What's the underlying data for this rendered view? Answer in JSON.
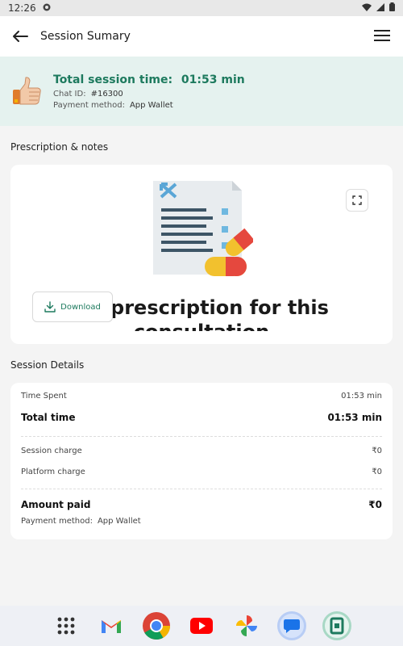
{
  "status_bar": {
    "time": "12:26"
  },
  "header": {
    "title": "Session Sumary"
  },
  "summary": {
    "total_label": "Total session time:",
    "total_value": "01:53 min",
    "chat_id_label": "Chat ID:",
    "chat_id_value": "#16300",
    "payment_label": "Payment method:",
    "payment_value": "App Wallet"
  },
  "prescription": {
    "section_title": "Prescription & notes",
    "empty_text": "No prescription for this consultation",
    "download_label": "Download"
  },
  "details": {
    "section_title": "Session Details",
    "time_spent_label": "Time Spent",
    "time_spent_value": "01:53 min",
    "total_time_label": "Total time",
    "total_time_value": "01:53 min",
    "session_charge_label": "Session charge",
    "session_charge_value": "₹0",
    "platform_charge_label": "Platform charge",
    "platform_charge_value": "₹0",
    "amount_paid_label": "Amount paid",
    "amount_paid_value": "₹0",
    "payment_method_label": "Payment method:",
    "payment_method_value": "App Wallet"
  },
  "dock": [
    "apps-grid-icon",
    "gmail-icon",
    "chrome-icon",
    "youtube-icon",
    "photos-icon",
    "messages-icon",
    "app-icon"
  ],
  "colors": {
    "accent": "#1d7a5e",
    "summary_bg": "#e5f2ef"
  }
}
